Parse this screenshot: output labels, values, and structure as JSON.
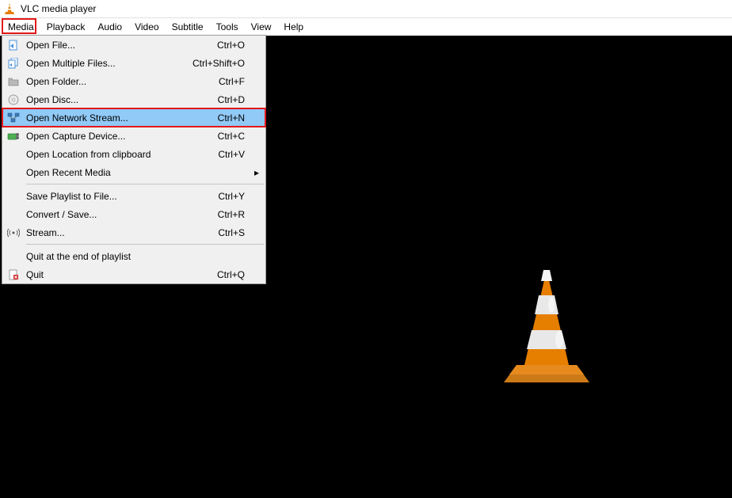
{
  "titlebar": {
    "title": "VLC media player"
  },
  "menubar": {
    "items": [
      {
        "label": "Media",
        "active": true
      },
      {
        "label": "Playback"
      },
      {
        "label": "Audio"
      },
      {
        "label": "Video"
      },
      {
        "label": "Subtitle"
      },
      {
        "label": "Tools"
      },
      {
        "label": "View"
      },
      {
        "label": "Help"
      }
    ]
  },
  "dropdown": {
    "groups": [
      [
        {
          "icon": "file-icon",
          "label": "Open File...",
          "shortcut": "Ctrl+O"
        },
        {
          "icon": "files-icon",
          "label": "Open Multiple Files...",
          "shortcut": "Ctrl+Shift+O"
        },
        {
          "icon": "folder-icon",
          "label": "Open Folder...",
          "shortcut": "Ctrl+F"
        },
        {
          "icon": "disc-icon",
          "label": "Open Disc...",
          "shortcut": "Ctrl+D"
        },
        {
          "icon": "network-icon",
          "label": "Open Network Stream...",
          "shortcut": "Ctrl+N",
          "highlighted": true,
          "redbox": true
        },
        {
          "icon": "capture-icon",
          "label": "Open Capture Device...",
          "shortcut": "Ctrl+C"
        },
        {
          "icon": "",
          "label": "Open Location from clipboard",
          "shortcut": "Ctrl+V"
        },
        {
          "icon": "",
          "label": "Open Recent Media",
          "submenu": true
        }
      ],
      [
        {
          "icon": "",
          "label": "Save Playlist to File...",
          "shortcut": "Ctrl+Y"
        },
        {
          "icon": "",
          "label": "Convert / Save...",
          "shortcut": "Ctrl+R"
        },
        {
          "icon": "stream-icon",
          "label": "Stream...",
          "shortcut": "Ctrl+S"
        }
      ],
      [
        {
          "icon": "",
          "label": "Quit at the end of playlist"
        },
        {
          "icon": "quit-icon",
          "label": "Quit",
          "shortcut": "Ctrl+Q"
        }
      ]
    ]
  }
}
